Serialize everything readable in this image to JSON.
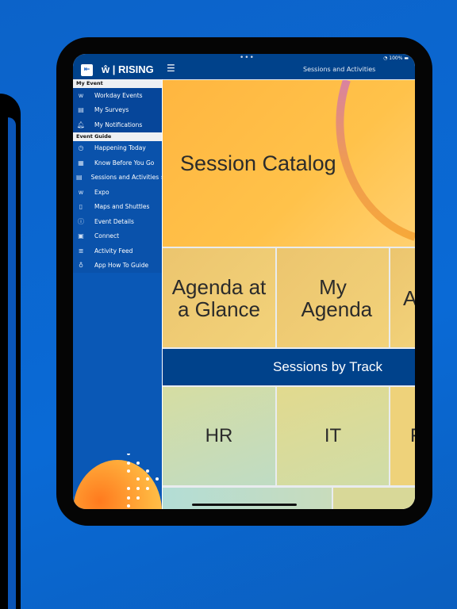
{
  "status_bar": {
    "dots": "•••",
    "battery": "100%"
  },
  "header": {
    "brand": "RISING",
    "title": "Sessions and Activities",
    "menu_icon": "hamburger-icon"
  },
  "sidebar": {
    "sections": [
      {
        "title": "My Event",
        "items": [
          {
            "label": "Workday Events",
            "icon": "w"
          },
          {
            "label": "My Surveys",
            "icon": "▤"
          },
          {
            "label": "My Notifications",
            "icon": "🔔︎"
          }
        ]
      },
      {
        "title": "Event Guide",
        "items": [
          {
            "label": "Happening Today",
            "icon": "◷"
          },
          {
            "label": "Know Before You Go",
            "icon": "▦"
          },
          {
            "label": "Sessions and Activities  ›",
            "icon": "▤"
          },
          {
            "label": "Expo",
            "icon": "w"
          },
          {
            "label": "Maps and Shuttles",
            "icon": "▯"
          },
          {
            "label": "Event Details",
            "icon": "ⓘ"
          },
          {
            "label": "Connect",
            "icon": "▣"
          },
          {
            "label": "Activity Feed",
            "icon": "≣"
          },
          {
            "label": "App How To Guide",
            "icon": "♁"
          }
        ]
      }
    ]
  },
  "tiles": {
    "catalog": "Session Catalog",
    "row2": [
      "Agenda at a Glance",
      "My Agenda",
      "A"
    ],
    "banner": "Sessions by Track",
    "row3": [
      "HR",
      "IT",
      "F"
    ]
  }
}
